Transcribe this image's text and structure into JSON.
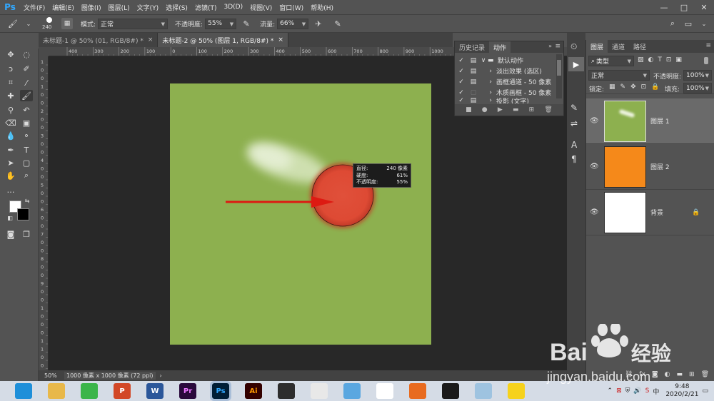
{
  "app": {
    "logo": "Ps"
  },
  "menu": [
    "文件(F)",
    "编辑(E)",
    "图像(I)",
    "图层(L)",
    "文字(Y)",
    "选择(S)",
    "滤镜(T)",
    "3D(D)",
    "视图(V)",
    "窗口(W)",
    "帮助(H)"
  ],
  "window_controls": {
    "minimize": "—",
    "maximize": "□",
    "close": "✕"
  },
  "options": {
    "brush_size": "240",
    "mode_label": "模式:",
    "mode_value": "正常",
    "opacity_label": "不透明度:",
    "opacity_value": "55%",
    "flow_label": "流量:",
    "flow_value": "66%"
  },
  "tabs": [
    {
      "label": "未标题-1 @ 50% (01, RGB/8#) *",
      "close": "×"
    },
    {
      "label": "未标题-2 @ 50% (图层 1, RGB/8#) *",
      "close": "×"
    }
  ],
  "ruler_top_ticks": [
    "400",
    "300",
    "200",
    "100",
    "0",
    "100",
    "200",
    "300",
    "400",
    "500",
    "600",
    "700",
    "800",
    "900",
    "1000",
    "1100",
    "1200",
    "1300",
    "1400"
  ],
  "ruler_left_ticks": [
    "1",
    "0",
    "0",
    "1",
    "0",
    "0",
    "2",
    "0",
    "0",
    "3",
    "0",
    "0",
    "4",
    "0",
    "0",
    "5",
    "0",
    "0",
    "6",
    "0",
    "0",
    "7",
    "0",
    "0",
    "8",
    "0",
    "0",
    "9",
    "0",
    "0",
    "1",
    "0",
    "0",
    "0",
    "1",
    "1",
    "0",
    "0"
  ],
  "canvas": {
    "color": "#8db04f",
    "brush_color": "#e0503a",
    "arrow_color": "#dd1a12"
  },
  "brush_tooltip": {
    "rows": [
      {
        "label": "直径:",
        "value": "240 像素"
      },
      {
        "label": "硬度:",
        "value": "61%"
      },
      {
        "label": "不透明度:",
        "value": "55%"
      }
    ]
  },
  "status": {
    "zoom": "50%",
    "doc_info": "1000 像素 x 1000 像素 (72 ppi)",
    "arrow": "›"
  },
  "actions_panel": {
    "tabs": [
      "历史记录",
      "动作"
    ],
    "rows": [
      {
        "label": "默认动作",
        "arrow": "∨",
        "folder": true
      },
      {
        "label": "淡出效果 (选区)",
        "arrow": "›"
      },
      {
        "label": "画框通道 - 50 像素",
        "arrow": "›"
      },
      {
        "label": "木质画框 - 50 像素",
        "arrow": "›"
      },
      {
        "label": "投影 (文字)",
        "arrow": "›"
      }
    ]
  },
  "layers_panel": {
    "tabs": [
      "图层",
      "通道",
      "路径"
    ],
    "filter_label": "类型",
    "blend_mode": "正常",
    "opacity_label": "不透明度:",
    "opacity_value": "100%",
    "lock_label": "锁定:",
    "fill_label": "填充:",
    "fill_value": "100%",
    "layers": [
      {
        "name": "图层 1",
        "color": "#8db04f",
        "selected": true
      },
      {
        "name": "图层 2",
        "color": "#f5891a",
        "selected": false
      },
      {
        "name": "背景",
        "color": "#ffffff",
        "selected": false,
        "locked": true
      }
    ]
  },
  "taskbar": {
    "apps": [
      {
        "label": "",
        "color": "#1e8fd9"
      },
      {
        "label": "",
        "color": "#e8b84a"
      },
      {
        "label": "",
        "color": "#3bb54a"
      },
      {
        "label": "P",
        "color": "#d24726"
      },
      {
        "label": "W",
        "color": "#2b579a"
      },
      {
        "label": "Pr",
        "color": "#2a0a3c"
      },
      {
        "label": "Ps",
        "color": "#001e36"
      },
      {
        "label": "Ai",
        "color": "#330000"
      },
      {
        "label": "",
        "color": "#2d2d2d"
      },
      {
        "label": "",
        "color": "#e8e8e8"
      },
      {
        "label": "",
        "color": "#5aa7e0"
      },
      {
        "label": "",
        "color": "#ffffff"
      },
      {
        "label": "",
        "color": "#e86b1f"
      },
      {
        "label": "",
        "color": "#1a1a1a"
      },
      {
        "label": "",
        "color": "#9ec3e0"
      },
      {
        "label": "",
        "color": "#f6d21c"
      }
    ],
    "time": "9:48",
    "date": "2020/2/21"
  },
  "watermark": {
    "brand": "Bai",
    "brand2": "经验",
    "url": "jingyan.baidu.com"
  }
}
